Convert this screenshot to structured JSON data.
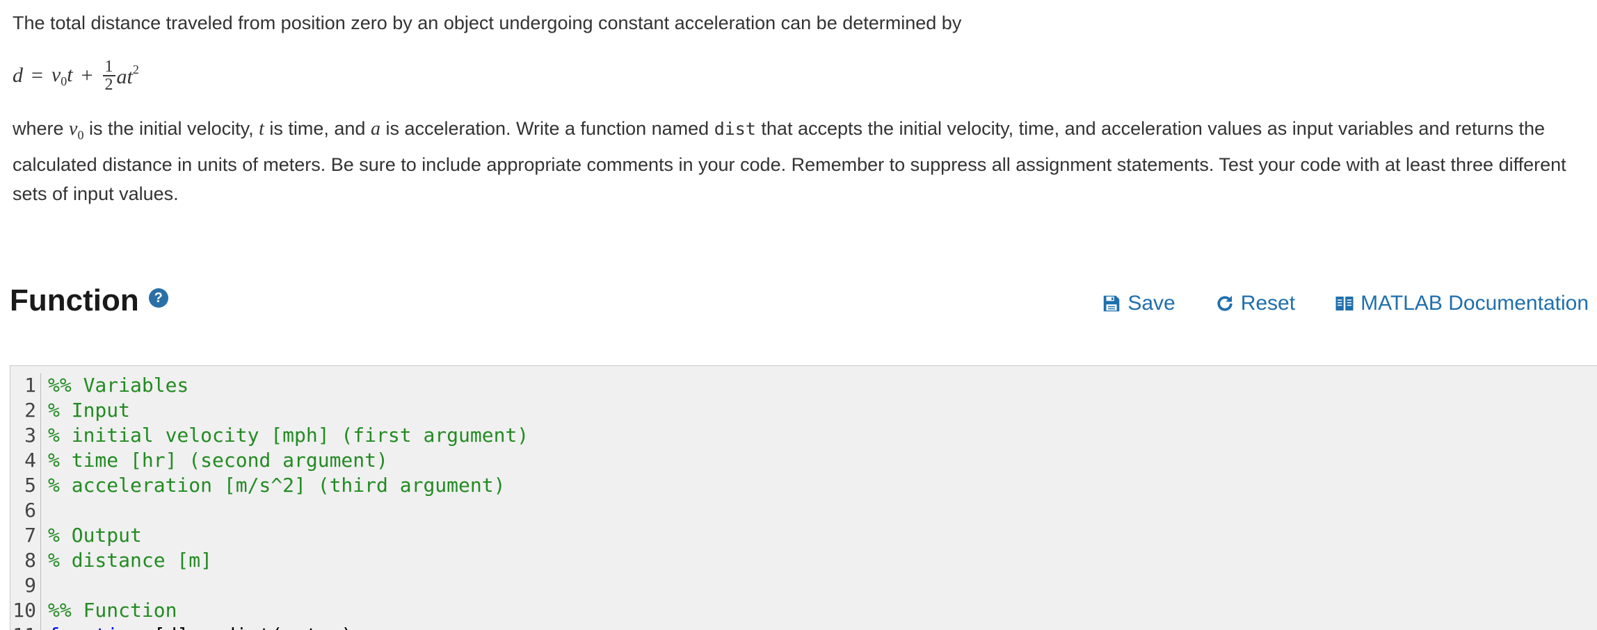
{
  "problem": {
    "intro": "The total distance traveled from position zero by an object undergoing constant acceleration can be determined by",
    "formula": {
      "lhs": "d",
      "equals": "=",
      "term1": "v",
      "term1_sub": "0",
      "term1_t": "t",
      "plus": "+",
      "frac_num": "1",
      "frac_den": "2",
      "term2": "at",
      "term2_sup": "2"
    },
    "desc_1": "where ",
    "desc_v": "v",
    "desc_v_sub": "0",
    "desc_2": " is the initial velocity, ",
    "desc_t": "t",
    "desc_3": " is time, and ",
    "desc_a": "a",
    "desc_4": " is acceleration. Write a function named ",
    "desc_code": "dist",
    "desc_5": " that accepts the initial velocity, time, and acceleration values as input variables and returns the calculated distance in units of meters. Be sure to include appropriate comments in your code. Remember to suppress all assignment statements. Test your code with at least three different sets of input values."
  },
  "function_section": {
    "title": "Function",
    "help_glyph": "?",
    "save_label": "Save",
    "reset_label": "Reset",
    "docs_label": "MATLAB Documentation",
    "accent_color": "#1f6fad"
  },
  "editor": {
    "lines": [
      {
        "n": "1",
        "text": "%% Variables"
      },
      {
        "n": "2",
        "text": "% Input"
      },
      {
        "n": "3",
        "text": "% initial velocity [mph] (first argument)"
      },
      {
        "n": "4",
        "text": "% time [hr] (second argument)"
      },
      {
        "n": "5",
        "text": "% acceleration [m/s^2] (third argument)"
      },
      {
        "n": "6",
        "text": ""
      },
      {
        "n": "7",
        "text": "% Output"
      },
      {
        "n": "8",
        "text": "% distance [m]"
      },
      {
        "n": "9",
        "text": ""
      },
      {
        "n": "10",
        "text": "%% Function"
      },
      {
        "n": "11",
        "kw": "function",
        "rest": " [d] = dist(v,t,a)"
      }
    ]
  }
}
